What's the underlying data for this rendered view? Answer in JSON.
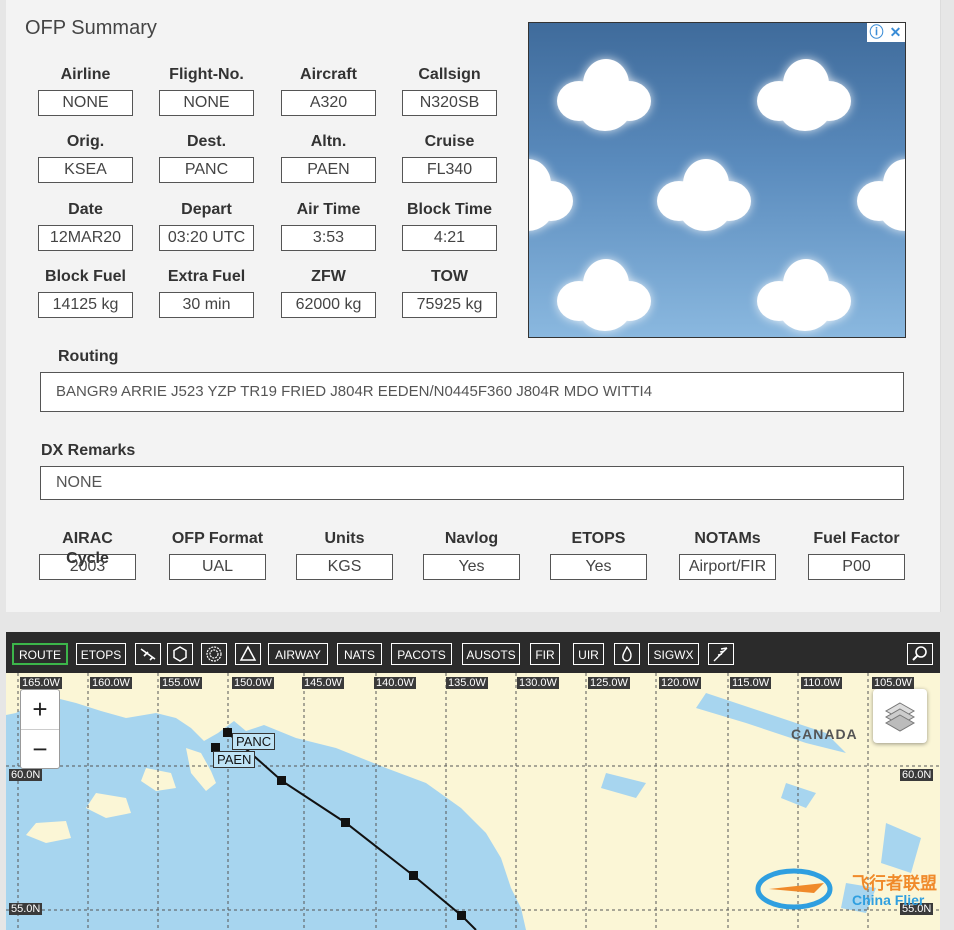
{
  "title": "OFP Summary",
  "fields": [
    {
      "label": "Airline",
      "value": "NONE"
    },
    {
      "label": "Flight-No.",
      "value": "NONE"
    },
    {
      "label": "Aircraft",
      "value": "A320"
    },
    {
      "label": "Callsign",
      "value": "N320SB"
    },
    {
      "label": "Orig.",
      "value": "KSEA"
    },
    {
      "label": "Dest.",
      "value": "PANC"
    },
    {
      "label": "Altn.",
      "value": "PAEN"
    },
    {
      "label": "Cruise",
      "value": "FL340"
    },
    {
      "label": "Date",
      "value": "12MAR20"
    },
    {
      "label": "Depart",
      "value": "03:20 UTC"
    },
    {
      "label": "Air Time",
      "value": "3:53"
    },
    {
      "label": "Block Time",
      "value": "4:21"
    },
    {
      "label": "Block Fuel",
      "value": "14125 kg"
    },
    {
      "label": "Extra Fuel",
      "value": "30 min"
    },
    {
      "label": "ZFW",
      "value": "62000 kg"
    },
    {
      "label": "TOW",
      "value": "75925 kg"
    }
  ],
  "routing": {
    "label": "Routing",
    "value": "BANGR9 ARRIE J523 YZP TR19 FRIED J804R EEDEN/N0445F360 J804R MDO WITTI4"
  },
  "remarks": {
    "label": "DX Remarks",
    "value": "NONE"
  },
  "bottom_fields": [
    {
      "label": "AIRAC Cycle",
      "value": "2003"
    },
    {
      "label": "OFP Format",
      "value": "UAL"
    },
    {
      "label": "Units",
      "value": "KGS"
    },
    {
      "label": "Navlog",
      "value": "Yes"
    },
    {
      "label": "ETOPS",
      "value": "Yes"
    },
    {
      "label": "NOTAMs",
      "value": "Airport/FIR"
    },
    {
      "label": "Fuel Factor",
      "value": "P00"
    }
  ],
  "ad": {
    "info": "ⓘ",
    "close": "✕"
  },
  "toolbar": {
    "route": "ROUTE",
    "etops": "ETOPS",
    "airway": "AIRWAY",
    "nats": "NATS",
    "pacots": "PACOTS",
    "ausots": "AUSOTS",
    "fir": "FIR",
    "uir": "UIR",
    "sigwx": "SIGWX"
  },
  "map": {
    "lon_labels": [
      "165.0W",
      "160.0W",
      "155.0W",
      "150.0W",
      "145.0W",
      "140.0W",
      "135.0W",
      "130.0W",
      "125.0W",
      "120.0W",
      "115.0W",
      "110.0W",
      "105.0W"
    ],
    "lat_labels": [
      "60.0N",
      "55.0N"
    ],
    "country": "CANADA",
    "airports": [
      "PANC",
      "PAEN"
    ],
    "zoom_in": "+",
    "zoom_out": "−",
    "watermark_cn": "飞行者联盟",
    "watermark_en": "China Flier"
  }
}
